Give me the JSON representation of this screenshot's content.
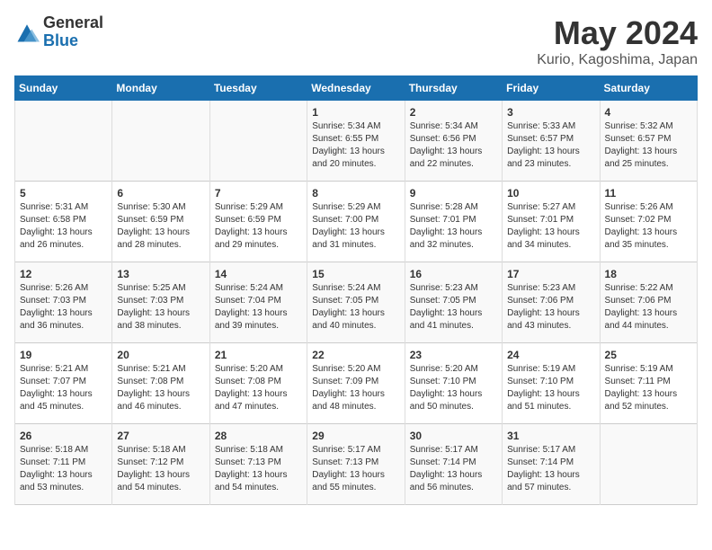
{
  "logo": {
    "general": "General",
    "blue": "Blue"
  },
  "title": "May 2024",
  "subtitle": "Kurio, Kagoshima, Japan",
  "days_of_week": [
    "Sunday",
    "Monday",
    "Tuesday",
    "Wednesday",
    "Thursday",
    "Friday",
    "Saturday"
  ],
  "weeks": [
    [
      {
        "num": "",
        "info": ""
      },
      {
        "num": "",
        "info": ""
      },
      {
        "num": "",
        "info": ""
      },
      {
        "num": "1",
        "info": "Sunrise: 5:34 AM\nSunset: 6:55 PM\nDaylight: 13 hours\nand 20 minutes."
      },
      {
        "num": "2",
        "info": "Sunrise: 5:34 AM\nSunset: 6:56 PM\nDaylight: 13 hours\nand 22 minutes."
      },
      {
        "num": "3",
        "info": "Sunrise: 5:33 AM\nSunset: 6:57 PM\nDaylight: 13 hours\nand 23 minutes."
      },
      {
        "num": "4",
        "info": "Sunrise: 5:32 AM\nSunset: 6:57 PM\nDaylight: 13 hours\nand 25 minutes."
      }
    ],
    [
      {
        "num": "5",
        "info": "Sunrise: 5:31 AM\nSunset: 6:58 PM\nDaylight: 13 hours\nand 26 minutes."
      },
      {
        "num": "6",
        "info": "Sunrise: 5:30 AM\nSunset: 6:59 PM\nDaylight: 13 hours\nand 28 minutes."
      },
      {
        "num": "7",
        "info": "Sunrise: 5:29 AM\nSunset: 6:59 PM\nDaylight: 13 hours\nand 29 minutes."
      },
      {
        "num": "8",
        "info": "Sunrise: 5:29 AM\nSunset: 7:00 PM\nDaylight: 13 hours\nand 31 minutes."
      },
      {
        "num": "9",
        "info": "Sunrise: 5:28 AM\nSunset: 7:01 PM\nDaylight: 13 hours\nand 32 minutes."
      },
      {
        "num": "10",
        "info": "Sunrise: 5:27 AM\nSunset: 7:01 PM\nDaylight: 13 hours\nand 34 minutes."
      },
      {
        "num": "11",
        "info": "Sunrise: 5:26 AM\nSunset: 7:02 PM\nDaylight: 13 hours\nand 35 minutes."
      }
    ],
    [
      {
        "num": "12",
        "info": "Sunrise: 5:26 AM\nSunset: 7:03 PM\nDaylight: 13 hours\nand 36 minutes."
      },
      {
        "num": "13",
        "info": "Sunrise: 5:25 AM\nSunset: 7:03 PM\nDaylight: 13 hours\nand 38 minutes."
      },
      {
        "num": "14",
        "info": "Sunrise: 5:24 AM\nSunset: 7:04 PM\nDaylight: 13 hours\nand 39 minutes."
      },
      {
        "num": "15",
        "info": "Sunrise: 5:24 AM\nSunset: 7:05 PM\nDaylight: 13 hours\nand 40 minutes."
      },
      {
        "num": "16",
        "info": "Sunrise: 5:23 AM\nSunset: 7:05 PM\nDaylight: 13 hours\nand 41 minutes."
      },
      {
        "num": "17",
        "info": "Sunrise: 5:23 AM\nSunset: 7:06 PM\nDaylight: 13 hours\nand 43 minutes."
      },
      {
        "num": "18",
        "info": "Sunrise: 5:22 AM\nSunset: 7:06 PM\nDaylight: 13 hours\nand 44 minutes."
      }
    ],
    [
      {
        "num": "19",
        "info": "Sunrise: 5:21 AM\nSunset: 7:07 PM\nDaylight: 13 hours\nand 45 minutes."
      },
      {
        "num": "20",
        "info": "Sunrise: 5:21 AM\nSunset: 7:08 PM\nDaylight: 13 hours\nand 46 minutes."
      },
      {
        "num": "21",
        "info": "Sunrise: 5:20 AM\nSunset: 7:08 PM\nDaylight: 13 hours\nand 47 minutes."
      },
      {
        "num": "22",
        "info": "Sunrise: 5:20 AM\nSunset: 7:09 PM\nDaylight: 13 hours\nand 48 minutes."
      },
      {
        "num": "23",
        "info": "Sunrise: 5:20 AM\nSunset: 7:10 PM\nDaylight: 13 hours\nand 50 minutes."
      },
      {
        "num": "24",
        "info": "Sunrise: 5:19 AM\nSunset: 7:10 PM\nDaylight: 13 hours\nand 51 minutes."
      },
      {
        "num": "25",
        "info": "Sunrise: 5:19 AM\nSunset: 7:11 PM\nDaylight: 13 hours\nand 52 minutes."
      }
    ],
    [
      {
        "num": "26",
        "info": "Sunrise: 5:18 AM\nSunset: 7:11 PM\nDaylight: 13 hours\nand 53 minutes."
      },
      {
        "num": "27",
        "info": "Sunrise: 5:18 AM\nSunset: 7:12 PM\nDaylight: 13 hours\nand 54 minutes."
      },
      {
        "num": "28",
        "info": "Sunrise: 5:18 AM\nSunset: 7:13 PM\nDaylight: 13 hours\nand 54 minutes."
      },
      {
        "num": "29",
        "info": "Sunrise: 5:17 AM\nSunset: 7:13 PM\nDaylight: 13 hours\nand 55 minutes."
      },
      {
        "num": "30",
        "info": "Sunrise: 5:17 AM\nSunset: 7:14 PM\nDaylight: 13 hours\nand 56 minutes."
      },
      {
        "num": "31",
        "info": "Sunrise: 5:17 AM\nSunset: 7:14 PM\nDaylight: 13 hours\nand 57 minutes."
      },
      {
        "num": "",
        "info": ""
      }
    ]
  ]
}
